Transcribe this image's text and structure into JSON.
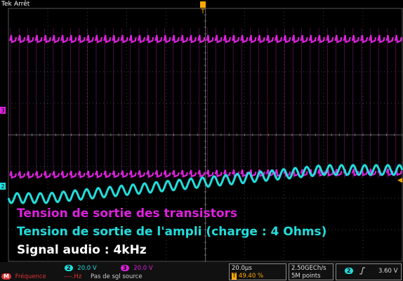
{
  "header": {
    "brand": "Tek",
    "acquisition_state": "Arrêt"
  },
  "channels": [
    {
      "id": "2",
      "color": "#22dddd",
      "scale": "20.0 V"
    },
    {
      "id": "3",
      "color": "#dd22dd",
      "scale": "20.0 V"
    }
  ],
  "markers": {
    "trigger_position": "T",
    "ch3_marker": "3",
    "ch2_marker": "2",
    "trigger_level_arrow": "◀"
  },
  "captions": {
    "line1": "Tension de sortie des transistors",
    "line2": "Tension de sortie de l'ampli (charge : 4 Ohms)",
    "line3": "Signal audio : 4kHz"
  },
  "colors": {
    "magenta": "#dd22dd",
    "cyan": "#22dddd",
    "white": "#ffffff",
    "grid": "#555555",
    "trigger": "#ffaa00"
  },
  "timebase": {
    "scale": "20.0µs",
    "trigger_position": "49.40 %",
    "trigger_position_icon": "T"
  },
  "acquisition": {
    "rate": "2.50GECh/s",
    "record_length": "5M points"
  },
  "trigger": {
    "source": "2",
    "slope_icon": "rising-edge",
    "level": "3.60 V"
  },
  "measurement": {
    "source": "M",
    "label": "Fréquence",
    "value": "----.Hz",
    "note": "Pas de sgl source"
  },
  "waveforms": {
    "magenta_high_level": 0.82,
    "magenta_low_level": 0.15,
    "magenta_pulse_count": 46,
    "cyan_cycles": 34,
    "cyan_amplitude_div": 0.2
  }
}
